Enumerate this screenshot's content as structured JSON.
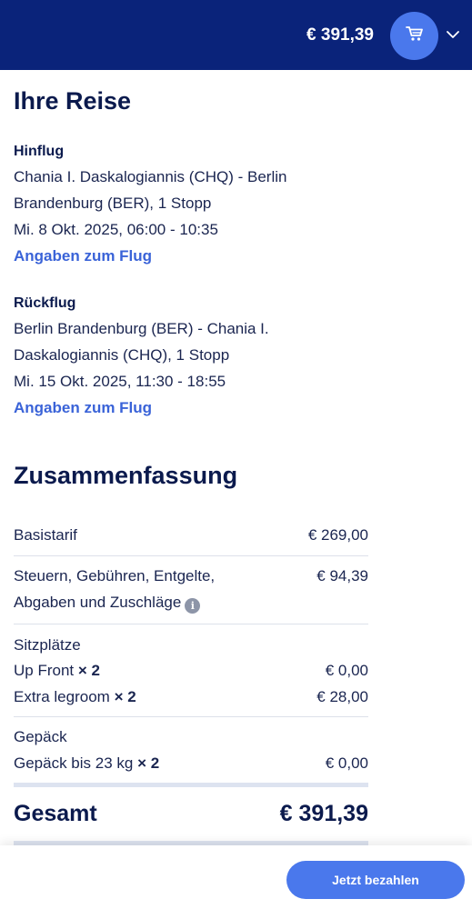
{
  "header": {
    "cart_total": "€ 391,39",
    "cart_icon": "shopping-cart-icon",
    "chevron_icon": "chevron-down-icon",
    "colors": {
      "bar": "#0a237a",
      "accent": "#4a78ec"
    }
  },
  "trip": {
    "title": "Ihre Reise",
    "outbound": {
      "label": "Hinflug",
      "route_line1": "Chania I. Daskalogiannis (CHQ) - Berlin",
      "route_line2": "Brandenburg (BER), 1 Stopp",
      "datetime": "Mi. 8 Okt. 2025, 06:00 - 10:35",
      "details_link": "Angaben zum Flug"
    },
    "return": {
      "label": "Rückflug",
      "route_line1": "Berlin Brandenburg (BER) - Chania I.",
      "route_line2": "Daskalogiannis (CHQ), 1 Stopp",
      "datetime": "Mi. 15 Okt. 2025, 11:30 - 18:55",
      "details_link": "Angaben zum Flug"
    }
  },
  "summary": {
    "title": "Zusammenfassung",
    "base_fare": {
      "label": "Basistarif",
      "value": "€ 269,00"
    },
    "taxes": {
      "label_line1": "Steuern, Gebühren, Entgelte,",
      "label_line2": "Abgaben und Zuschläge",
      "value": "€ 94,39",
      "info_icon": "info-icon"
    },
    "seats": {
      "label": "Sitzplätze",
      "items": [
        {
          "label": "Up Front",
          "qty": "× 2",
          "value": "€ 0,00"
        },
        {
          "label": "Extra legroom",
          "qty": "× 2",
          "value": "€ 28,00"
        }
      ]
    },
    "baggage": {
      "label": "Gepäck",
      "items": [
        {
          "label": "Gepäck bis 23 kg",
          "qty": "× 2",
          "value": "€ 0,00"
        }
      ]
    },
    "total": {
      "label": "Gesamt",
      "value": "€ 391,39"
    }
  },
  "footer": {
    "pay_button": "Jetzt bezahlen"
  }
}
